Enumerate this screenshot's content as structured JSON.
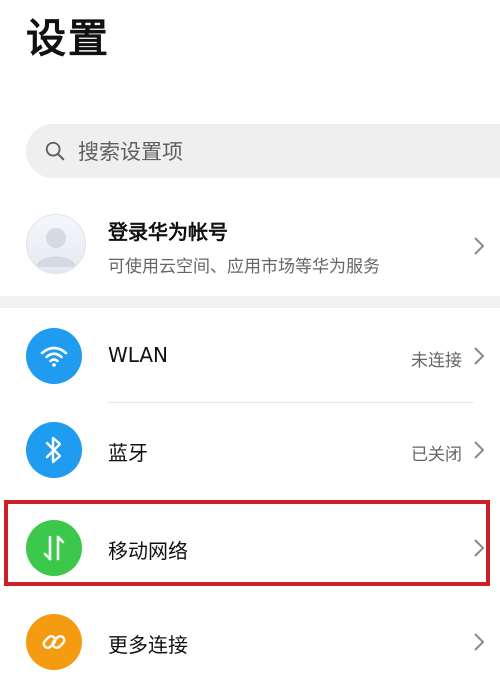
{
  "header": {
    "title": "设置"
  },
  "search": {
    "placeholder": "搜索设置项"
  },
  "account": {
    "title": "登录华为帐号",
    "subtitle": "可使用云空间、应用市场等华为服务"
  },
  "settings": {
    "items": [
      {
        "label": "WLAN",
        "value": "未连接",
        "icon": "wifi-icon",
        "color": "#1f9bf0"
      },
      {
        "label": "蓝牙",
        "value": "已关闭",
        "icon": "bluetooth-icon",
        "color": "#1f9bf0"
      },
      {
        "label": "移动网络",
        "value": "",
        "icon": "mobile-data-icon",
        "color": "#3cc84a"
      },
      {
        "label": "更多连接",
        "value": "",
        "icon": "link-icon",
        "color": "#f59b12"
      }
    ]
  },
  "colors": {
    "highlight": "#cc1f26",
    "search_bg": "#efefef"
  }
}
